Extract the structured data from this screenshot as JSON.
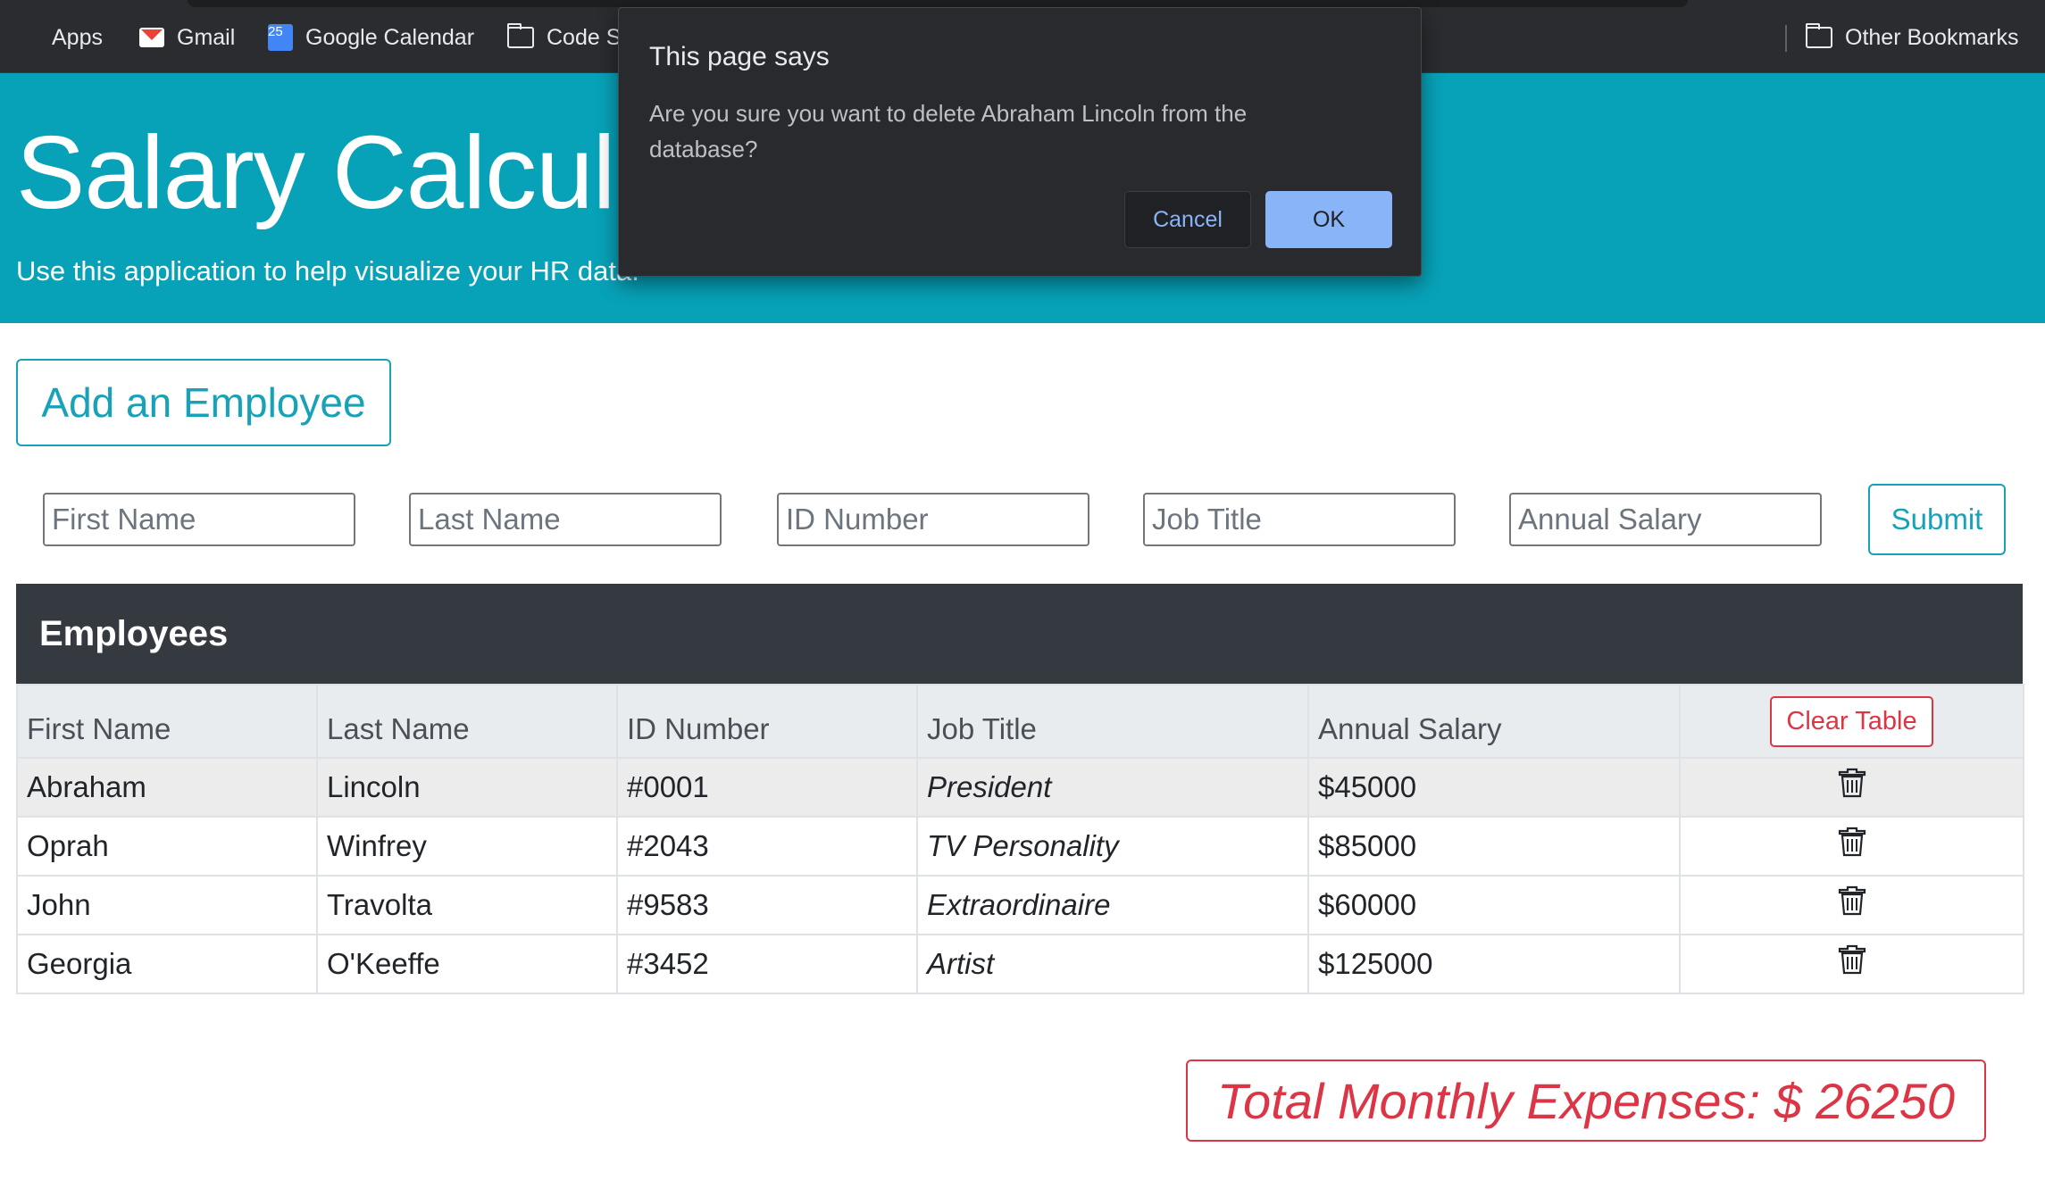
{
  "bookmarks": {
    "items": [
      {
        "label": "Apps",
        "icon": "apps-grid-icon"
      },
      {
        "label": "Gmail",
        "icon": "gmail-icon"
      },
      {
        "label": "Google Calendar",
        "icon": "calendar-icon",
        "icon_text": "25"
      },
      {
        "label": "Code S",
        "icon": "folder-icon"
      }
    ],
    "other": {
      "label": "Other Bookmarks",
      "icon": "folder-icon"
    }
  },
  "header": {
    "title": "Salary Calcul",
    "subtitle": "Use this application to help visualize your HR data."
  },
  "form": {
    "add_button": "Add an Employee",
    "fields": [
      {
        "placeholder": "First Name",
        "value": ""
      },
      {
        "placeholder": "Last Name",
        "value": ""
      },
      {
        "placeholder": "ID Number",
        "value": ""
      },
      {
        "placeholder": "Job Title",
        "value": ""
      },
      {
        "placeholder": "Annual Salary",
        "value": ""
      }
    ],
    "submit": "Submit"
  },
  "employees": {
    "heading": "Employees",
    "columns": [
      "First Name",
      "Last Name",
      "ID Number",
      "Job Title",
      "Annual Salary"
    ],
    "clear_button": "Clear Table",
    "rows": [
      {
        "first": "Abraham",
        "last": "Lincoln",
        "id": "#0001",
        "title": "President",
        "salary": "$45000",
        "highlighted": true
      },
      {
        "first": "Oprah",
        "last": "Winfrey",
        "id": "#2043",
        "title": "TV Personality",
        "salary": "$85000",
        "highlighted": false
      },
      {
        "first": "John",
        "last": "Travolta",
        "id": "#9583",
        "title": "Extraordinaire",
        "salary": "$60000",
        "highlighted": false
      },
      {
        "first": "Georgia",
        "last": "O'Keeffe",
        "id": "#3452",
        "title": "Artist",
        "salary": "$125000",
        "highlighted": false
      }
    ],
    "row_action_icon": "trash-icon"
  },
  "total": {
    "label": "Total Monthly Expenses: $ 26250"
  },
  "dialog": {
    "title": "This page says",
    "message": "Are you sure you want to delete Abraham Lincoln from the database?",
    "cancel": "Cancel",
    "ok": "OK"
  },
  "colors": {
    "header_bg": "#07a2b8",
    "accent": "#17a2b8",
    "danger": "#dc3545",
    "table_header_bg": "#343a40",
    "dialog_bg": "#292a2d",
    "dialog_ok": "#8ab4f8"
  }
}
